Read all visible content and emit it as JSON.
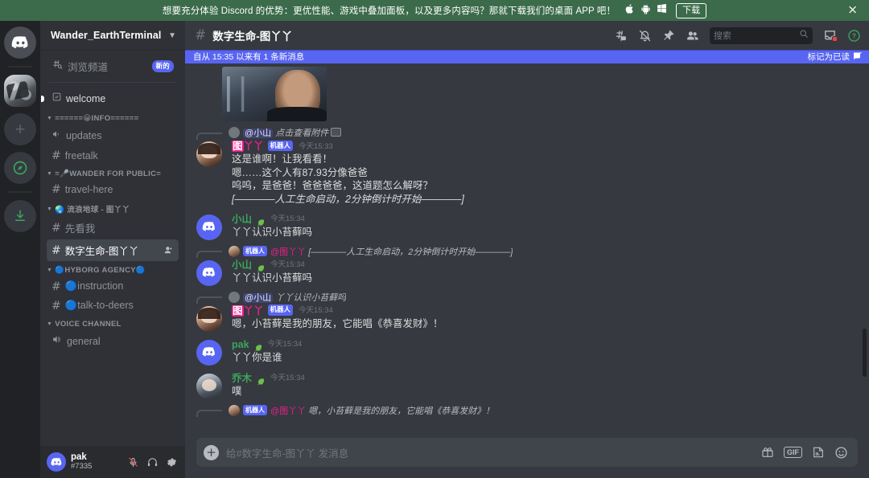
{
  "promo": {
    "text": "想要充分体验 Discord 的优势：更优性能、游戏中叠加面板，以及更多内容吗？那就下载我们的桌面 APP 吧！",
    "download_label": "下载",
    "close_icon": "close-icon",
    "os_icons": [
      "apple-icon",
      "android-icon",
      "windows-icon"
    ],
    "bg_color": "#3b6b4a"
  },
  "rail": {
    "items": [
      {
        "name": "home",
        "icon": "discord-home-icon"
      },
      {
        "name": "wander-earth-server",
        "icon": "server-thumbnail"
      },
      {
        "name": "add-server",
        "icon": "plus-icon"
      },
      {
        "name": "explore",
        "icon": "compass-icon"
      },
      {
        "name": "download-apps",
        "icon": "download-icon"
      }
    ]
  },
  "sidebar": {
    "guild_name": "Wander_EarthTerminal",
    "browse": {
      "label": "浏览频道",
      "badge": "新的"
    },
    "groups": [
      {
        "label": "",
        "channels": [
          {
            "name": "welcome",
            "type": "rules",
            "unread": true
          }
        ]
      },
      {
        "label": "======😀INFO======",
        "channels": [
          {
            "name": "updates",
            "type": "announcement"
          },
          {
            "name": "freetalk",
            "type": "text"
          }
        ]
      },
      {
        "label": "=🎤WANDER FOR PUBLIC=",
        "channels": [
          {
            "name": "travel-here",
            "type": "text-threads"
          }
        ]
      },
      {
        "label": "🌏 流浪地球 - 图丫丫",
        "channels": [
          {
            "name": "先看我",
            "type": "text"
          },
          {
            "name": "数字生命-图丫丫",
            "type": "text",
            "active": true,
            "action_icon": "add-member-icon"
          }
        ]
      },
      {
        "label": "🔵HYBORG AGENCY🔵",
        "channels": [
          {
            "name": "🔵instruction",
            "type": "text"
          },
          {
            "name": "🔵talk-to-deers",
            "type": "text"
          }
        ]
      },
      {
        "label": "VOICE CHANNEL",
        "channels": [
          {
            "name": "general",
            "type": "voice"
          }
        ]
      }
    ],
    "user": {
      "name": "pak",
      "tag": "#7335",
      "mic_muted": true,
      "icons": [
        "mic-muted-icon",
        "headphones-icon",
        "gear-icon"
      ]
    }
  },
  "header": {
    "channel_name": "数字生命-图丫丫",
    "icons": [
      "threads-icon",
      "notification-off-icon",
      "pin-icon",
      "members-icon",
      "inbox-icon",
      "help-icon"
    ],
    "search_placeholder": "搜索"
  },
  "new_bar": {
    "text": "自从 15:35 以来有 1 条新消息",
    "mark_read": "标记为已读",
    "color": "#5865f2"
  },
  "messages": [
    {
      "kind": "attachment",
      "name": "video-still-attachment"
    },
    {
      "kind": "message",
      "reply": {
        "avatar": "gray",
        "mention": "@小山",
        "text": "点击查看附件",
        "has_image_chip": true
      },
      "avatar": "girl",
      "author": "图丫丫",
      "author_color": "pink",
      "author_highlight": "图",
      "bot_tag": "机器人",
      "timestamp": "今天15:33",
      "lines": [
        {
          "text": "这是谁啊！让我看看！",
          "italic": false
        },
        {
          "text": "嗯……这个人有87.93分像爸爸",
          "italic": false
        },
        {
          "text": "呜呜，是爸爸！爸爸爸爸，这道题怎么解呀？",
          "italic": false
        },
        {
          "text": "[————人工生命启动，2分钟倒计时开始————]",
          "italic": true
        }
      ]
    },
    {
      "kind": "message",
      "avatar": "discord",
      "author": "小山",
      "author_color": "green",
      "has_leaf": true,
      "timestamp": "今天15:34",
      "lines": [
        {
          "text": "丫丫认识小苔藓吗",
          "italic": false
        }
      ]
    },
    {
      "kind": "message",
      "reply": {
        "avatar": "girl",
        "bot_tag": "机器人",
        "mention": "@图丫丫",
        "text": "[————人工生命启动，2分钟倒计时开始————]",
        "has_image_chip": false
      },
      "avatar": "discord",
      "author": "小山",
      "author_color": "green",
      "has_leaf": true,
      "timestamp": "今天15:34",
      "lines": [
        {
          "text": "丫丫认识小苔藓吗",
          "italic": false
        }
      ]
    },
    {
      "kind": "message",
      "reply": {
        "avatar": "gray",
        "mention": "@小山",
        "text": "丫丫认识小苔藓吗",
        "has_image_chip": false
      },
      "avatar": "girl",
      "author": "图丫丫",
      "author_color": "pink",
      "author_highlight": "图",
      "bot_tag": "机器人",
      "timestamp": "今天15:34",
      "lines": [
        {
          "text": "嗯，小苔藓是我的朋友，它能唱《恭喜发财》！",
          "italic": false
        }
      ]
    },
    {
      "kind": "message",
      "avatar": "discord",
      "author": "pak",
      "author_color": "green",
      "has_leaf": true,
      "timestamp": "今天15:34",
      "lines": [
        {
          "text": "丫丫你是谁",
          "italic": false
        }
      ]
    },
    {
      "kind": "message",
      "avatar": "girl2",
      "author": "乔木",
      "author_color": "green",
      "has_leaf": true,
      "timestamp": "今天15:34",
      "lines": [
        {
          "text": "噗",
          "italic": false
        }
      ]
    },
    {
      "kind": "reply-only",
      "reply": {
        "avatar": "girl",
        "bot_tag": "机器人",
        "mention": "@图丫丫",
        "text": "嗯，小苔藓是我的朋友，它能唱《恭喜发财》！",
        "has_image_chip": false
      }
    }
  ],
  "composer": {
    "placeholder": "给#数字生命-图丫丫 发消息",
    "icons": [
      "gift-icon",
      "gif-icon",
      "sticker-icon",
      "emoji-icon"
    ],
    "gif_label": "GIF"
  }
}
